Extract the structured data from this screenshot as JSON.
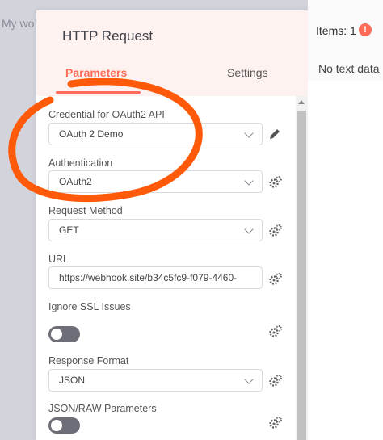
{
  "background": {
    "workflow_text": "My wo"
  },
  "panel": {
    "title": "HTTP Request",
    "tabs": [
      {
        "label": "Parameters",
        "active": true
      },
      {
        "label": "Settings",
        "active": false
      }
    ]
  },
  "fields": {
    "credential": {
      "label": "Credential for OAuth2 API",
      "value": "OAuth 2 Demo"
    },
    "authentication": {
      "label": "Authentication",
      "value": "OAuth2"
    },
    "request_method": {
      "label": "Request Method",
      "value": "GET"
    },
    "url": {
      "label": "URL",
      "value": "https://webhook.site/b34c5fc9-f079-4460-"
    },
    "ignore_ssl": {
      "label": "Ignore SSL Issues",
      "enabled": false
    },
    "response_format": {
      "label": "Response Format",
      "value": "JSON"
    },
    "json_raw": {
      "label": "JSON/RAW Parameters",
      "enabled": false
    }
  },
  "output": {
    "items_label": "Items: 1",
    "info_icon": "!",
    "no_data_text": "No text data"
  },
  "colors": {
    "accent": "#ff6d5a",
    "annotation": "#ff5a0a",
    "toggle_off": "#6e6e78"
  },
  "icons": [
    "pencil-icon",
    "gear-icon",
    "chevron-down-icon",
    "info-icon"
  ]
}
